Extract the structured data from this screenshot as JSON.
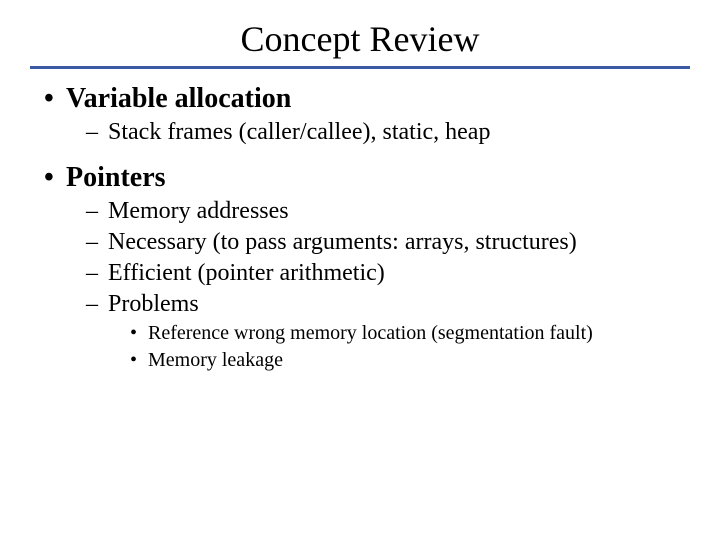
{
  "title": "Concept Review",
  "sections": [
    {
      "heading": "Variable allocation",
      "items": [
        {
          "text": "Stack frames (caller/callee), static, heap"
        }
      ]
    },
    {
      "heading": "Pointers",
      "items": [
        {
          "text": "Memory addresses"
        },
        {
          "text": "Necessary (to pass arguments: arrays, structures)"
        },
        {
          "text": "Efficient (pointer arithmetic)"
        },
        {
          "text": "Problems",
          "subitems": [
            "Reference wrong memory location (segmentation fault)",
            "Memory leakage"
          ]
        }
      ]
    }
  ]
}
